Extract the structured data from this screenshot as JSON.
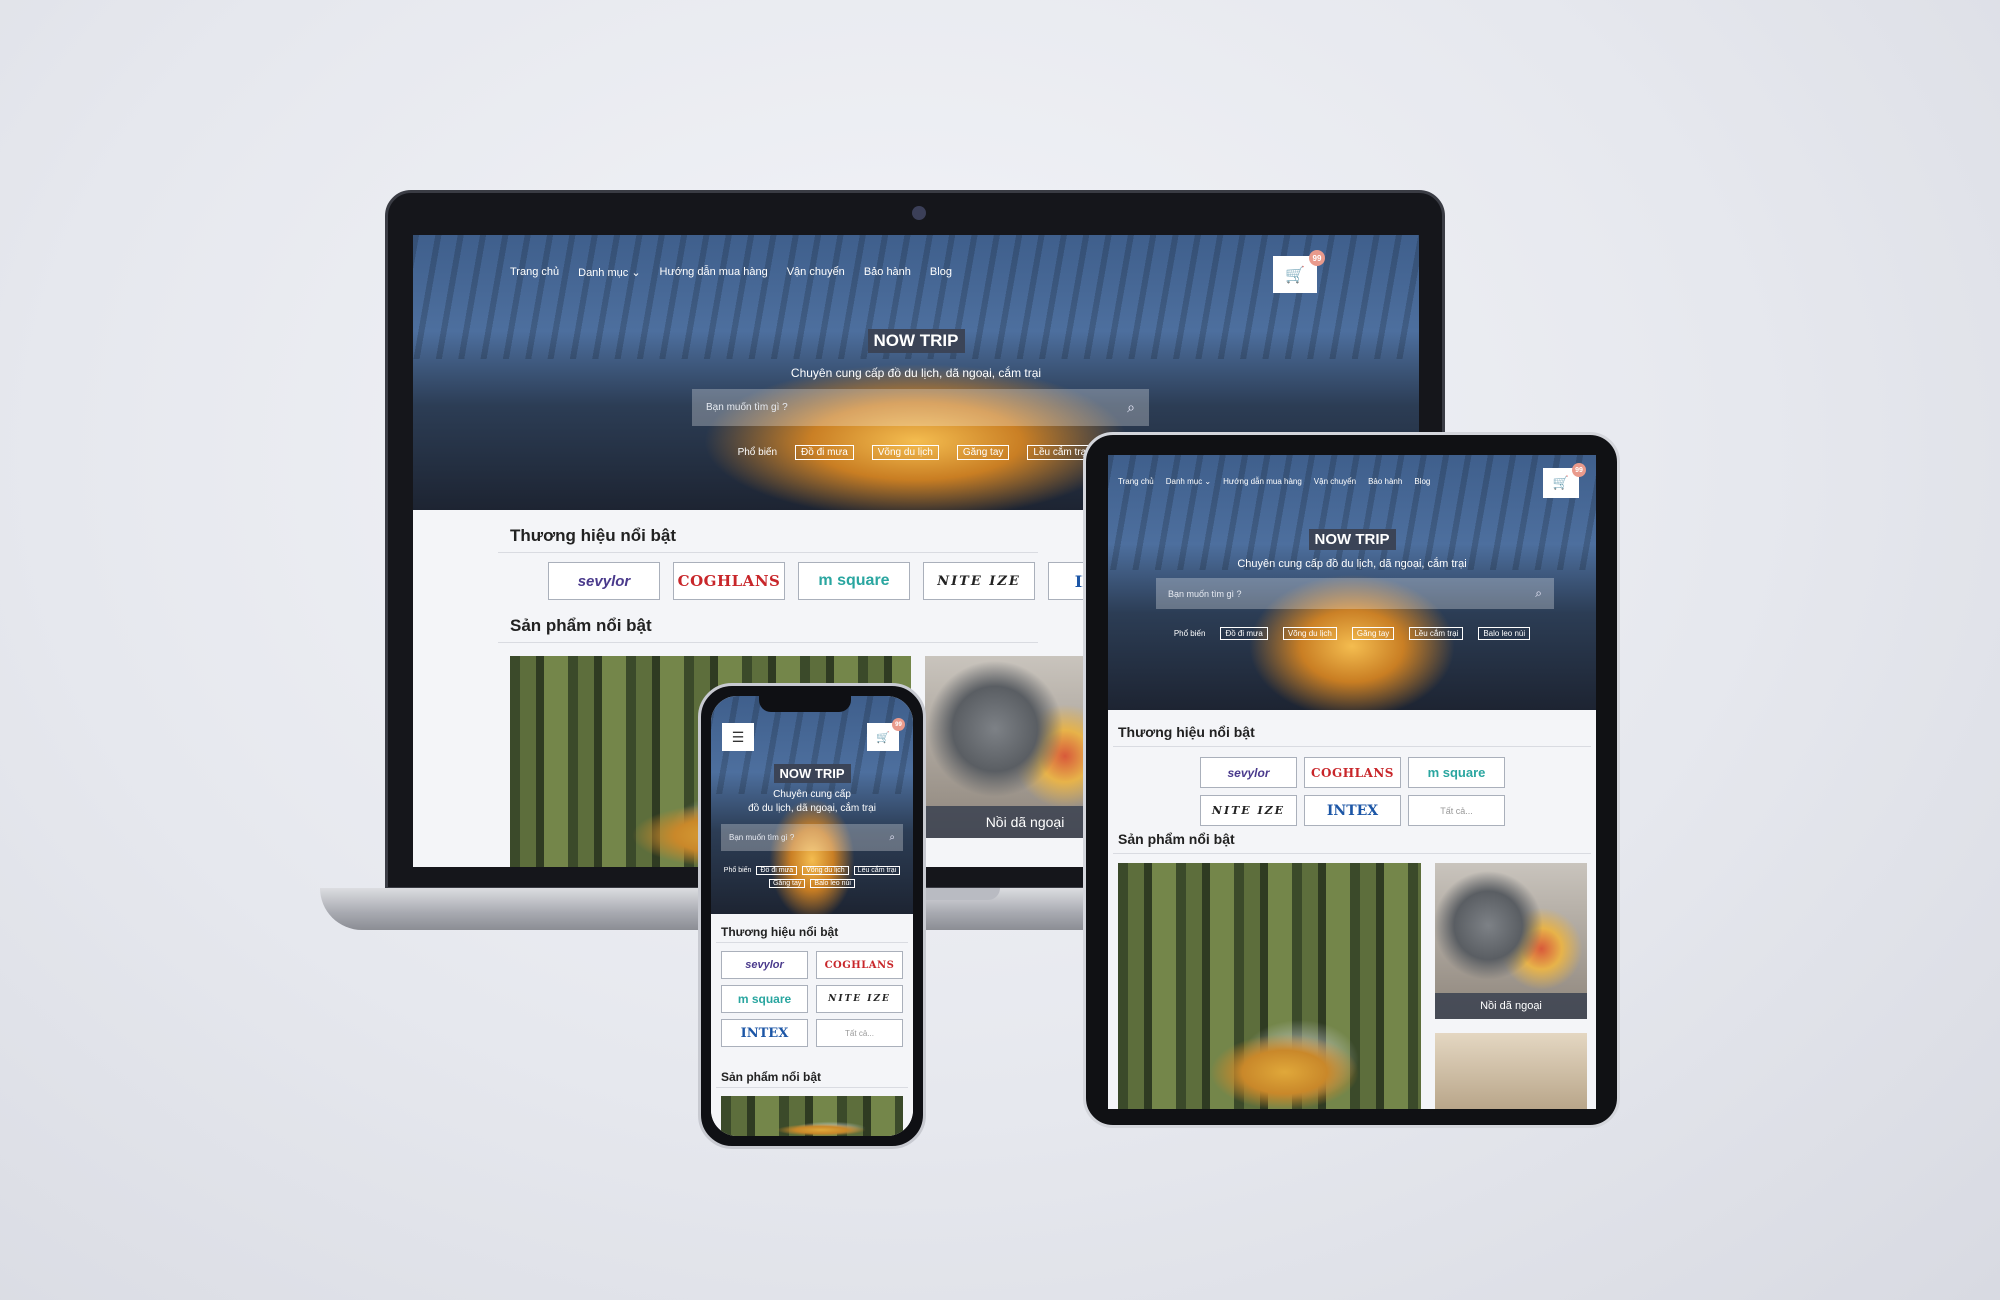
{
  "site": {
    "brand": "NOW TRIP",
    "tagline": "Chuyên cung cấp đồ du lịch, dã ngoại, cắm trại",
    "tagline_mobile_1": "Chuyên cung cấp",
    "tagline_mobile_2": "đồ du lịch, dã ngoại, cắm trại",
    "nav": [
      "Trang chủ",
      "Danh mục",
      "Hướng dẫn mua hàng",
      "Vận chuyển",
      "Bảo hành",
      "Blog"
    ],
    "cart_count": "99",
    "search_placeholder": "Bạn muốn tìm gì ?",
    "popular_label": "Phổ biến",
    "tags": [
      "Đồ đi mưa",
      "Võng du lịch",
      "Găng tay",
      "Lều cắm trại",
      "Balo leo núi"
    ],
    "brands_title": "Thương hiệu nổi bật",
    "products_title": "Sản phẩm nổi bật",
    "brands": [
      "sevylor",
      "COGHLANS",
      "m square",
      "NITE IZE",
      "INTEX"
    ],
    "brands_all": "Tất cả...",
    "product_captions": [
      "Nồi dã ngoại"
    ]
  },
  "colors": {
    "brand_bg": "#3b4457",
    "badge": "#e99a8c",
    "caption_bg": "#373e4e"
  },
  "icons": [
    "cart-icon",
    "search-icon",
    "chevron-down-icon",
    "hamburger-menu-icon"
  ]
}
